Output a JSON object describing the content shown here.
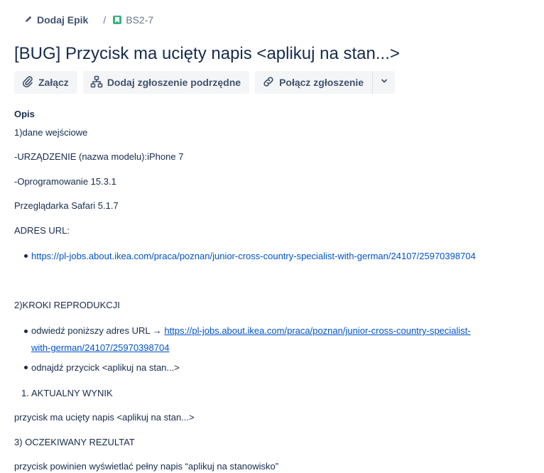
{
  "breadcrumb": {
    "epic_label": "Dodaj Epik",
    "separator": "/",
    "issue_key": "BS2-7"
  },
  "title": "[BUG] Przycisk ma ucięty napis <aplikuj na stan...>",
  "toolbar": {
    "attach": "Załącz",
    "add_child": "Dodaj zgłoszenie podrzędne",
    "link_issue": "Połącz zgłoszenie"
  },
  "description": {
    "heading": "Opis",
    "l1": "1)dane wejściowe",
    "l2": "-URZĄDZENIE (nazwa modelu):iPhone 7",
    "l3": "-Oprogramowanie 15.3.1",
    "l4": "Przeglądarka Safari 5.1.7",
    "l5": "ADRES URL:",
    "url": "https://pl-jobs.about.ikea.com/praca/poznan/junior-cross-country-specialist-with-german/24107/25970398704",
    "steps_heading": "2)KROKI REPRODUKCJI",
    "step1_prefix": "odwiedź poniższy adres URL → ",
    "step1_link_a": "https://pl-jobs.about.ikea.com/praca/poznan/junior-cross-country-specialist-",
    "step1_link_b": "with-german/24107/25970398704",
    "step2": "odnajdź przycick <aplikuj na stan...>",
    "actual_num": "1.",
    "actual_heading": "AKTUALNY WYNIK",
    "actual_text": "przycisk ma ucięty napis <aplikuj na stan...>",
    "expected_heading": "3) OCZEKIWANY REZULTAT",
    "expected_text": "przycisk powinien wyświetlać pełny napis “aplikuj na stanowisko”"
  },
  "colors": {
    "link": "#0052cc",
    "text": "#172b4d",
    "button_bg": "#f4f5f7",
    "story_icon": "#36b37e"
  },
  "icons": [
    "pencil-icon",
    "story-icon",
    "paperclip-icon",
    "hierarchy-icon",
    "link-icon",
    "chevron-down-icon"
  ]
}
